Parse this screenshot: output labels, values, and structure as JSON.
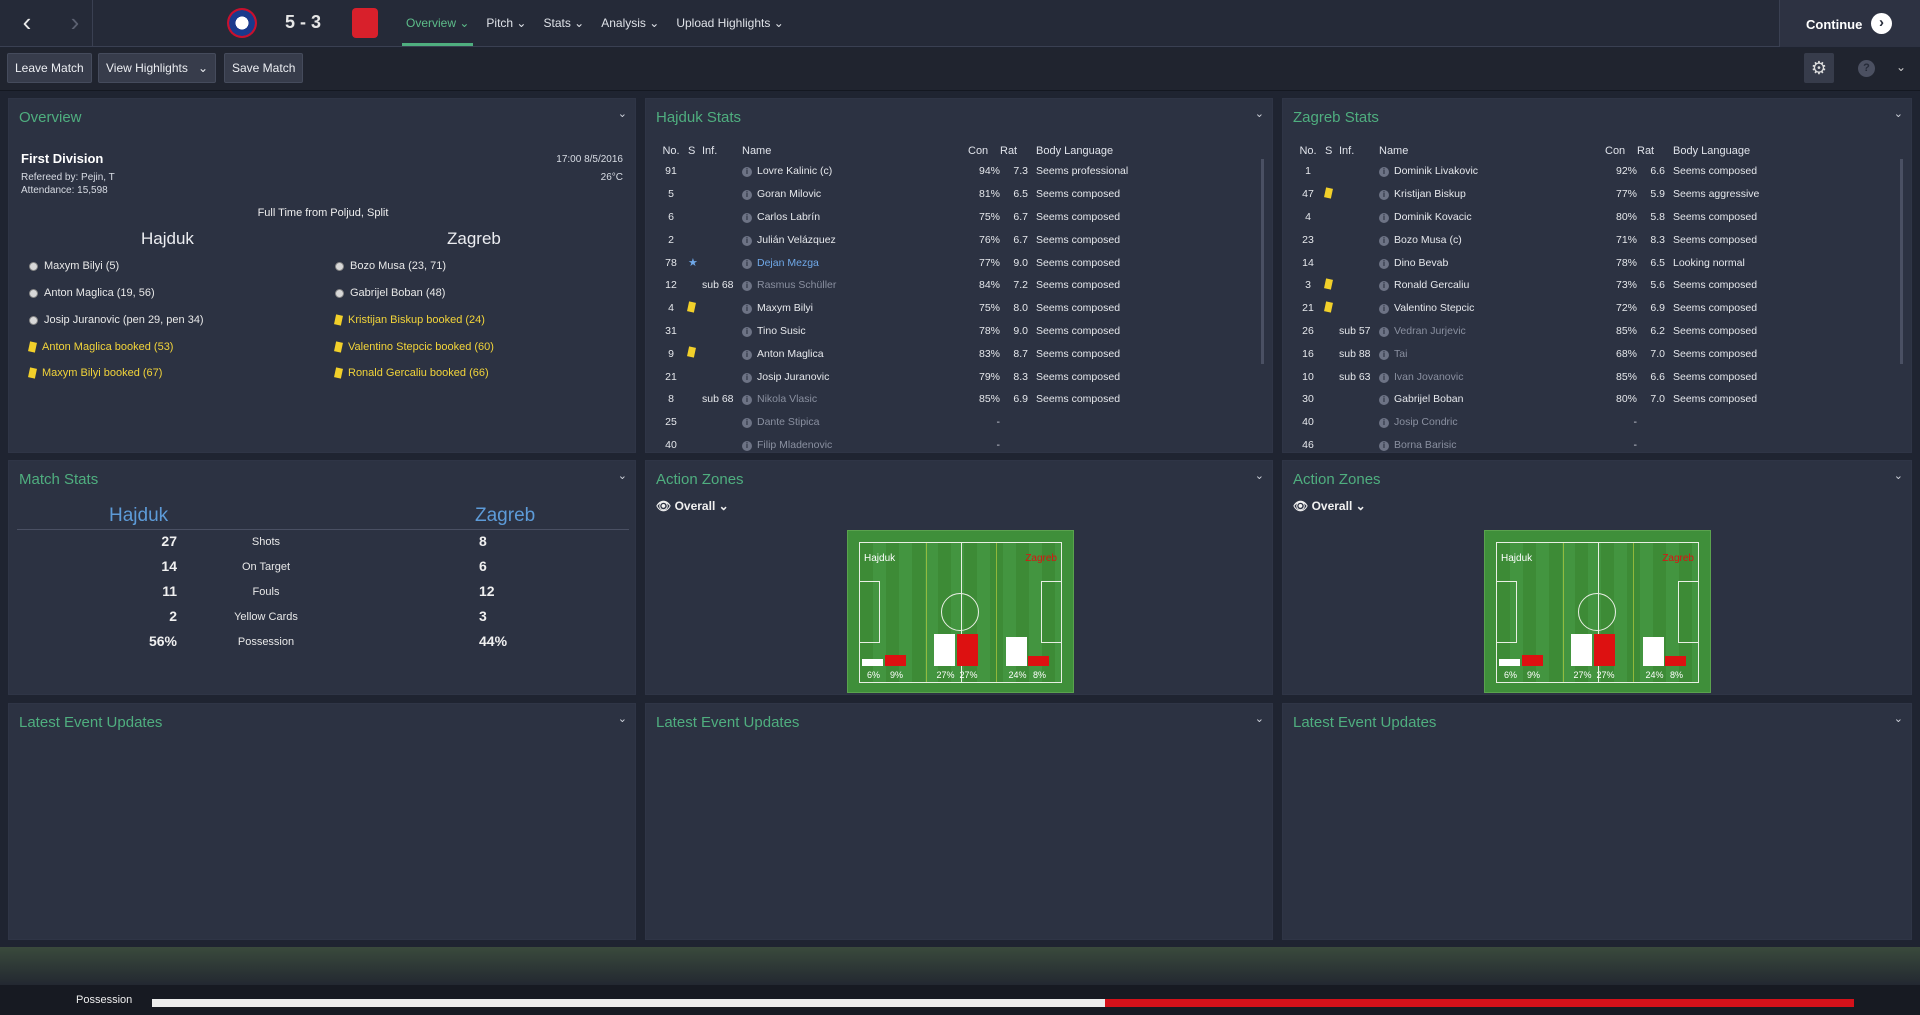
{
  "topbar": {
    "score": "5 - 3",
    "menu": [
      "Overview",
      "Pitch",
      "Stats",
      "Analysis",
      "Upload Highlights"
    ],
    "continue": "Continue"
  },
  "toolbar": {
    "leave": "Leave Match",
    "highlights": "View Highlights",
    "save": "Save Match"
  },
  "overview": {
    "title": "Overview",
    "competition": "First Division",
    "referee": "Refereed by: Pejin, T",
    "attendance": "Attendance: 15,598",
    "datetime": "17:00 8/5/2016",
    "temp": "26°C",
    "venue": "Full Time from Poljud, Split",
    "home": "Hajduk",
    "away": "Zagreb",
    "home_events": [
      {
        "t": "Maxym Bilyi (5)",
        "k": "goal"
      },
      {
        "t": "Anton Maglica (19, 56)",
        "k": "goal"
      },
      {
        "t": "Josip Juranovic (pen 29, pen 34)",
        "k": "goal"
      },
      {
        "t": "Anton Maglica booked (53)",
        "k": "card"
      },
      {
        "t": "Maxym Bilyi booked (67)",
        "k": "card"
      }
    ],
    "away_events": [
      {
        "t": "Bozo Musa (23, 71)",
        "k": "goal"
      },
      {
        "t": "Gabrijel Boban (48)",
        "k": "goal"
      },
      {
        "t": "Kristijan Biskup booked (24)",
        "k": "card"
      },
      {
        "t": "Valentino Stepcic booked (60)",
        "k": "card"
      },
      {
        "t": "Ronald Gercaliu booked (66)",
        "k": "card"
      }
    ]
  },
  "hajduk_stats": {
    "title": "Hajduk Stats",
    "headers": [
      "No.",
      "S",
      "Inf.",
      "Name",
      "Con",
      "Rat",
      "Body Language"
    ],
    "rows": [
      [
        "91",
        "",
        "",
        "Lovre Kalinic (c)",
        "94%",
        "7.3",
        "Seems professional"
      ],
      [
        "5",
        "",
        "",
        "Goran Milovic",
        "81%",
        "6.5",
        "Seems composed"
      ],
      [
        "6",
        "",
        "",
        "Carlos Labrín",
        "75%",
        "6.7",
        "Seems composed"
      ],
      [
        "2",
        "",
        "",
        "Julián Velázquez",
        "76%",
        "6.7",
        "Seems composed"
      ],
      [
        "78",
        "star",
        "",
        "Dejan Mezga",
        "77%",
        "9.0",
        "Seems composed"
      ],
      [
        "12",
        "",
        "sub 68",
        "Rasmus Schüller",
        "84%",
        "7.2",
        "Seems composed"
      ],
      [
        "4",
        "card",
        "",
        "Maxym Bilyi",
        "75%",
        "8.0",
        "Seems composed"
      ],
      [
        "31",
        "",
        "",
        "Tino Susic",
        "78%",
        "9.0",
        "Seems composed"
      ],
      [
        "9",
        "card",
        "",
        "Anton Maglica",
        "83%",
        "8.7",
        "Seems composed"
      ],
      [
        "21",
        "",
        "",
        "Josip Juranovic",
        "79%",
        "8.3",
        "Seems composed"
      ],
      [
        "8",
        "",
        "sub 68",
        "Nikola Vlasic",
        "85%",
        "6.9",
        "Seems composed"
      ],
      [
        "25",
        "",
        "",
        "Dante Stipica",
        "-",
        "",
        ""
      ],
      [
        "40",
        "",
        "",
        "Filip Mladenovic",
        "-",
        "",
        ""
      ]
    ]
  },
  "zagreb_stats": {
    "title": "Zagreb Stats",
    "headers": [
      "No.",
      "S",
      "Inf.",
      "Name",
      "Con",
      "Rat",
      "Body Language"
    ],
    "rows": [
      [
        "1",
        "",
        "",
        "Dominik Livakovic",
        "92%",
        "6.6",
        "Seems composed"
      ],
      [
        "47",
        "card",
        "",
        "Kristijan Biskup",
        "77%",
        "5.9",
        "Seems aggressive"
      ],
      [
        "4",
        "",
        "",
        "Dominik Kovacic",
        "80%",
        "5.8",
        "Seems composed"
      ],
      [
        "23",
        "",
        "",
        "Bozo Musa (c)",
        "71%",
        "8.3",
        "Seems composed"
      ],
      [
        "14",
        "",
        "",
        "Dino Bevab",
        "78%",
        "6.5",
        "Looking normal"
      ],
      [
        "3",
        "card",
        "",
        "Ronald Gercaliu",
        "73%",
        "5.6",
        "Seems composed"
      ],
      [
        "21",
        "card",
        "",
        "Valentino Stepcic",
        "72%",
        "6.9",
        "Seems composed"
      ],
      [
        "26",
        "",
        "sub 57",
        "Vedran Jurjevic",
        "85%",
        "6.2",
        "Seems composed"
      ],
      [
        "16",
        "",
        "sub 88",
        "Tai",
        "68%",
        "7.0",
        "Seems composed"
      ],
      [
        "10",
        "",
        "sub 63",
        "Ivan Jovanovic",
        "85%",
        "6.6",
        "Seems composed"
      ],
      [
        "30",
        "",
        "",
        "Gabrijel Boban",
        "80%",
        "7.0",
        "Seems composed"
      ],
      [
        "40",
        "",
        "",
        "Josip Condric",
        "-",
        "",
        ""
      ],
      [
        "46",
        "",
        "",
        "Borna Barisic",
        "-",
        "",
        ""
      ]
    ]
  },
  "match_stats": {
    "title": "Match Stats",
    "home": "Hajduk",
    "away": "Zagreb",
    "rows": [
      [
        "27",
        "Shots",
        "8"
      ],
      [
        "14",
        "On Target",
        "6"
      ],
      [
        "11",
        "Fouls",
        "12"
      ],
      [
        "2",
        "Yellow Cards",
        "3"
      ],
      [
        "56%",
        "Possession",
        "44%"
      ]
    ]
  },
  "action_zones": {
    "title": "Action Zones",
    "filter": "Overall",
    "home": "Hajduk",
    "away": "Zagreb",
    "labels": [
      "6%",
      "9%",
      "27%",
      "27%",
      "24%",
      "8%"
    ],
    "values": [
      6,
      9,
      27,
      27,
      24,
      8
    ]
  },
  "latest": "Latest Event Updates",
  "possession": {
    "label": "Possession",
    "home_pct": 56
  },
  "colors": {
    "accent": "#4fae7f",
    "home": "#ffffff",
    "away": "#dd1111"
  }
}
